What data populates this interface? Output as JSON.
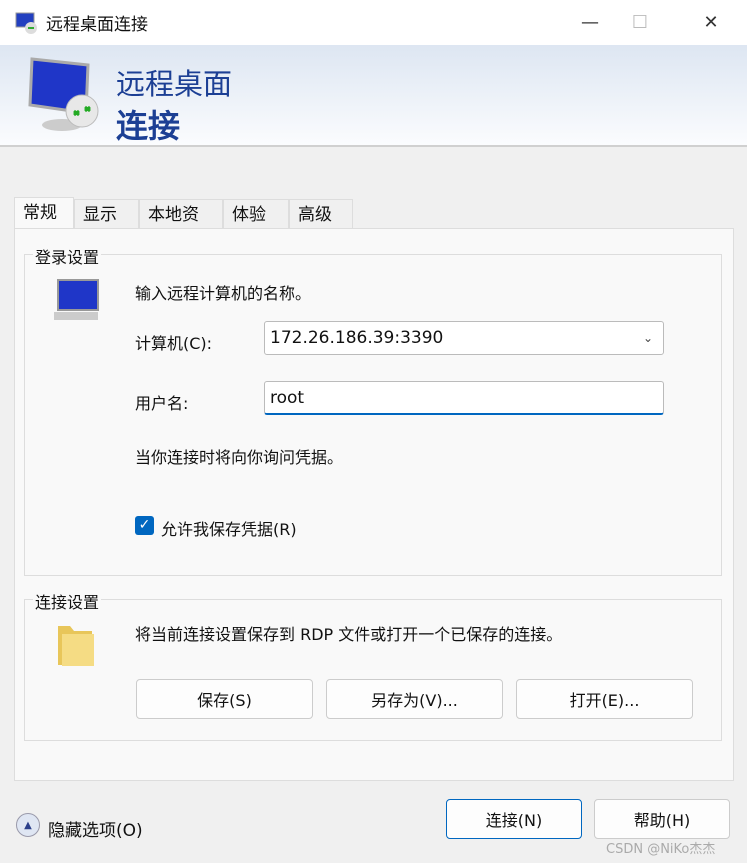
{
  "window": {
    "title": "远程桌面连接",
    "min": "—",
    "max": "☐",
    "close": "✕"
  },
  "banner": {
    "line1": "远程桌面",
    "line2": "连接"
  },
  "tabs": [
    "常规",
    "显示",
    "本地资源",
    "体验",
    "高级"
  ],
  "login": {
    "title": "登录设置",
    "prompt": "输入远程计算机的名称。",
    "computer_label": "计算机(C):",
    "computer_value": "172.26.186.39:3390",
    "user_label": "用户名:",
    "user_value": "root",
    "note": "当你连接时将向你询问凭据。",
    "allow_save": "允许我保存凭据(R)",
    "allow_save_checked": true
  },
  "conn": {
    "title": "连接设置",
    "desc": "将当前连接设置保存到 RDP 文件或打开一个已保存的连接。",
    "save": "保存(S)",
    "save_as": "另存为(V)...",
    "open": "打开(E)..."
  },
  "footer": {
    "hide_options": "隐藏选项(O)",
    "connect": "连接(N)",
    "help": "帮助(H)",
    "watermark": "CSDN @NiKo杰杰"
  }
}
